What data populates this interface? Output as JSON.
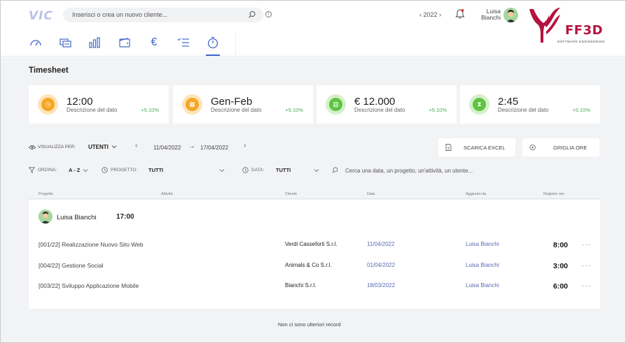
{
  "app": {
    "logo": "VIC"
  },
  "search": {
    "placeholder": "Inserisci o crea un nuovo cliente..."
  },
  "year": {
    "value": "2022",
    "prev": "‹",
    "next": "›"
  },
  "user": {
    "first_name": "Luisa",
    "last_name": "Bianchi"
  },
  "brand": {
    "name": "FF3D",
    "tagline": "SOFTWARE ENGINEERING",
    "color": "#b5123f"
  },
  "nav": {
    "items": [
      {
        "name": "dashboard-icon"
      },
      {
        "name": "clients-icon"
      },
      {
        "name": "bar-chart-icon"
      },
      {
        "name": "wallet-icon"
      },
      {
        "name": "euro-icon",
        "glyph": "€"
      },
      {
        "name": "checklist-icon"
      },
      {
        "name": "stopwatch-icon",
        "active": true
      }
    ],
    "accent": "#4466c8"
  },
  "page": {
    "title": "Timesheet"
  },
  "cards": [
    {
      "value": "12:00",
      "description": "Descrizione del dato",
      "delta": "+5.10%",
      "icon": "clock-icon",
      "color": "#f5a623"
    },
    {
      "value": "Gen-Feb",
      "description": "Descrizione del dato",
      "delta": "+5.10%",
      "icon": "calendar-icon",
      "color": "#f5a623"
    },
    {
      "value": "€ 12.000",
      "description": "Descrizione del dato",
      "delta": "+5.10%",
      "icon": "chart-icon",
      "color": "#5fc443"
    },
    {
      "value": "2:45",
      "description": "Descrizione del dato",
      "delta": "+5.10%",
      "icon": "hourglass-icon",
      "color": "#5fc443"
    }
  ],
  "view": {
    "label": "VISUALIZZA PER:",
    "value": "UTENTI"
  },
  "date_range": {
    "from": "11/04/2022",
    "arrow": "→",
    "to": "17/04/2022"
  },
  "buttons": {
    "excel": "SCARICA EXCEL",
    "grid": "GRIGLIA ORE"
  },
  "filters": {
    "order_label": "ORDINA:",
    "order_value": "A - Z",
    "project_label": "PROGETTO:",
    "project_value": "TUTTI",
    "date_label": "DATA:",
    "date_value": "TUTTI",
    "search_placeholder": "Cerca una data, un progetto, un'attività, un utente..."
  },
  "table": {
    "headers": [
      "Progetto",
      "Attività",
      "Cliente",
      "Data",
      "Aggiunto da",
      "Registro ore"
    ],
    "group": {
      "name": "Luisa Bianchi",
      "total": "17:00"
    },
    "rows": [
      {
        "project": "[001/22] Realizzazione Nuovo Sito Web",
        "client": "Verdi Casseforti S.r.l.",
        "date": "11/04/2022",
        "added_by": "Luisa Bianchi",
        "hours": "8:00",
        "more": "···"
      },
      {
        "project": "[004/22] Gestione Social",
        "client": "Animals & Co S.r.l.",
        "date": "01/04/2022",
        "added_by": "Luisa Bianchi",
        "hours": "3:00",
        "more": "···"
      },
      {
        "project": "[003/22] Sviluppo Applicazione Mobile",
        "client": "Bianchi S.r.l.",
        "date": "18/03/2022",
        "added_by": "Luisa Bianchi",
        "hours": "6:00",
        "more": "···"
      }
    ],
    "empty_message": "Non ci sono ulteriori record"
  }
}
